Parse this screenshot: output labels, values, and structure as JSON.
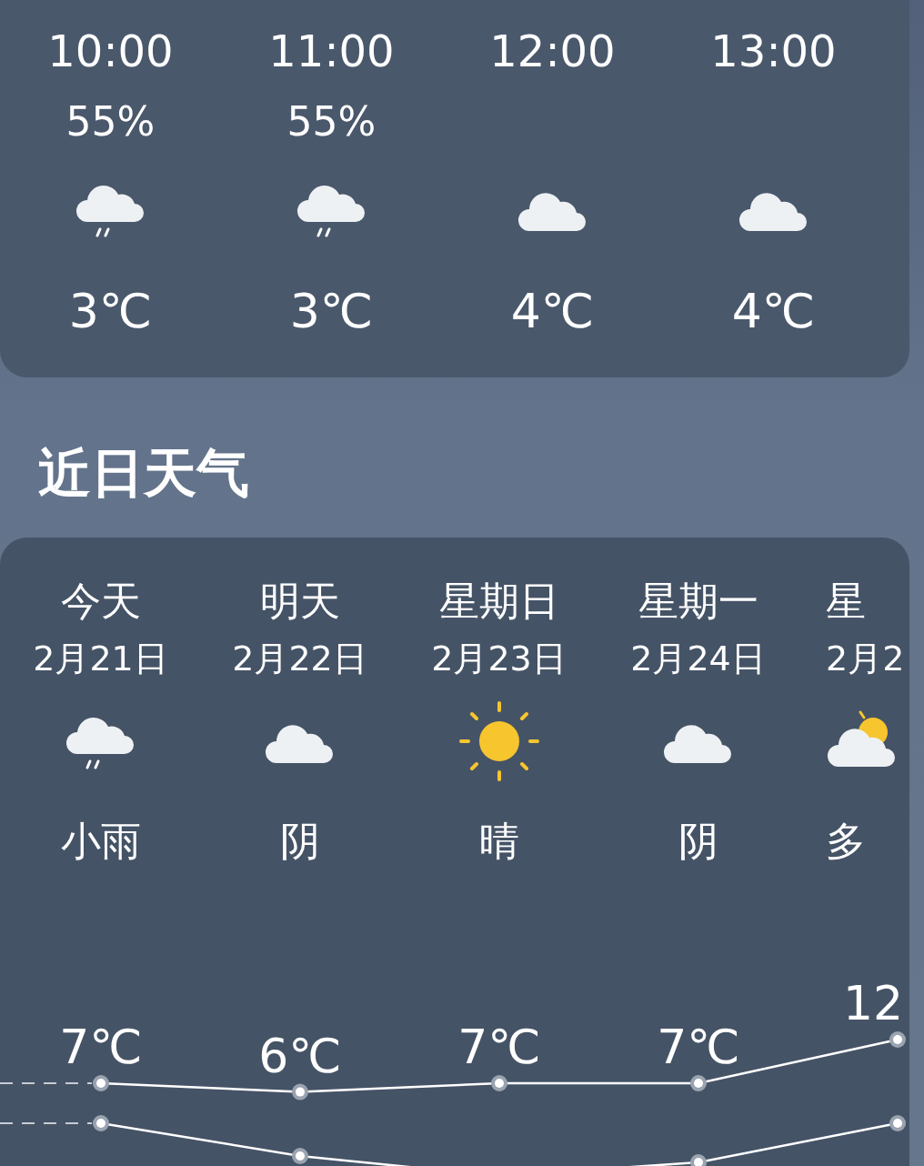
{
  "hourly": [
    {
      "time": "10:00",
      "humidity": "55%",
      "kind": "rain",
      "temp": "3℃"
    },
    {
      "time": "11:00",
      "humidity": "55%",
      "kind": "rain",
      "temp": "3℃"
    },
    {
      "time": "12:00",
      "kind": "cloudy",
      "temp": "4℃"
    },
    {
      "time": "13:00",
      "kind": "cloudy",
      "temp": "4℃"
    }
  ],
  "section_title": "近日天气",
  "days": [
    {
      "day": "今天",
      "date": "2月21日",
      "kind": "rain",
      "condition": "小雨",
      "clipped": false,
      "high": "7℃"
    },
    {
      "day": "明天",
      "date": "2月22日",
      "kind": "cloudy",
      "condition": "阴",
      "clipped": false,
      "high": "6℃"
    },
    {
      "day": "星期日",
      "date": "2月23日",
      "kind": "sunny",
      "condition": "晴",
      "clipped": false,
      "high": "7℃"
    },
    {
      "day": "星期一",
      "date": "2月24日",
      "kind": "cloudy",
      "condition": "阴",
      "clipped": false,
      "high": "7℃"
    },
    {
      "day": "星",
      "date": "2月2",
      "kind": "partly_cloudy",
      "condition": "多",
      "clipped": true,
      "high": "12"
    }
  ]
}
